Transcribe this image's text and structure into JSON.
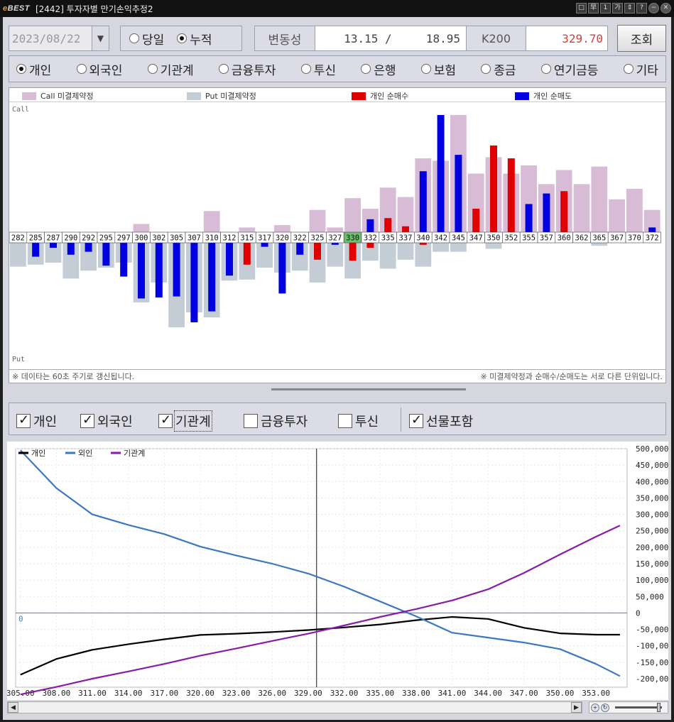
{
  "window": {
    "logo": "BEST",
    "title": "[2442] 투자자별 만기손익추정2",
    "controls": [
      "□",
      "早",
      "1",
      "가",
      "⇕",
      "?",
      "−",
      "✕"
    ]
  },
  "top": {
    "date": "2023/08/22",
    "mode_options": [
      {
        "label": "당일",
        "selected": false
      },
      {
        "label": "누적",
        "selected": true
      }
    ],
    "vol_label": "변동성",
    "vol_value": "13.15 /     18.95",
    "k200_label": "K200",
    "k200_value": "329.70",
    "query_button": "조회"
  },
  "investors": [
    {
      "label": "개인",
      "selected": true
    },
    {
      "label": "외국인",
      "selected": false
    },
    {
      "label": "기관계",
      "selected": false
    },
    {
      "label": "금융투자",
      "selected": false
    },
    {
      "label": "투신",
      "selected": false
    },
    {
      "label": "은행",
      "selected": false
    },
    {
      "label": "보험",
      "selected": false
    },
    {
      "label": "종금",
      "selected": false
    },
    {
      "label": "연기금등",
      "selected": false
    },
    {
      "label": "기타",
      "selected": false
    }
  ],
  "bar_panel": {
    "legend": [
      {
        "label": "Call 미결제약정",
        "color": "#d8bcd6"
      },
      {
        "label": "Put 미결제약정",
        "color": "#c4ccd6"
      },
      {
        "label": "개인 순매수",
        "color": "#e00000"
      },
      {
        "label": "개인 순매도",
        "color": "#0000e0"
      }
    ],
    "call_label": "Call",
    "put_label": "Put",
    "note_left": "※ 데이타는 60초 주기로 갱신됩니다.",
    "note_right": "※ 미결제약정과 순매수/순매도는 서로 다른 단위입니다.",
    "highlight_strike": "330"
  },
  "checks": {
    "items": [
      {
        "label": "개인",
        "checked": true
      },
      {
        "label": "외국인",
        "checked": true
      },
      {
        "label": "기관계",
        "checked": true
      },
      {
        "label": "금융투자",
        "checked": false
      },
      {
        "label": "투신",
        "checked": false
      }
    ],
    "futures": {
      "label": "선물포함",
      "checked": true
    }
  },
  "line_legend": [
    {
      "label": "개인",
      "color": "#000000"
    },
    {
      "label": "외인",
      "color": "#3a78c0"
    },
    {
      "label": "기관계",
      "color": "#8a1aa8"
    }
  ],
  "chart_data": [
    {
      "type": "bar",
      "categories": [
        "282",
        "285",
        "287",
        "290",
        "292",
        "295",
        "297",
        "300",
        "302",
        "305",
        "307",
        "310",
        "312",
        "315",
        "317",
        "320",
        "322",
        "325",
        "327",
        "330",
        "332",
        "335",
        "337",
        "340",
        "342",
        "345",
        "347",
        "350",
        "352",
        "355",
        "357",
        "360",
        "362",
        "365",
        "367",
        "370",
        "372"
      ],
      "series": [
        {
          "name": "Call 미결제약정",
          "values": [
            0,
            0,
            0,
            0,
            0,
            0,
            0,
            7,
            0,
            0,
            0,
            18,
            0,
            4,
            0,
            6,
            0,
            19,
            4,
            29,
            20,
            38,
            30,
            63,
            61,
            100,
            50,
            64,
            50,
            57,
            41,
            53,
            41,
            56,
            28,
            37,
            19
          ]
        },
        {
          "name": "개인 순매수",
          "values": [
            0,
            0,
            0,
            0,
            0,
            0,
            0,
            0,
            0,
            0,
            0,
            0,
            0,
            -22,
            0,
            0,
            0,
            -17,
            0,
            -18,
            -5,
            12,
            5,
            -2,
            0,
            0,
            20,
            74,
            63,
            0,
            0,
            35,
            0,
            0,
            0,
            0,
            0
          ]
        },
        {
          "name": "개인 순매도",
          "values": [
            0,
            -14,
            -5,
            -12,
            -9,
            -23,
            -34,
            -56,
            -55,
            -54,
            -80,
            -69,
            -33,
            0,
            -4,
            -51,
            -12,
            0,
            -2,
            0,
            11,
            0,
            0,
            52,
            100,
            66,
            0,
            0,
            0,
            24,
            33,
            0,
            0,
            0,
            0,
            0,
            4
          ]
        },
        {
          "name": "Put 미결제약정",
          "values": [
            -24,
            -22,
            -20,
            -36,
            -28,
            -25,
            -20,
            -60,
            -40,
            -85,
            -70,
            -75,
            -38,
            -37,
            -25,
            -30,
            -28,
            -40,
            -24,
            -36,
            -18,
            -26,
            -17,
            -24,
            -9,
            -9,
            0,
            -6,
            0,
            0,
            0,
            0,
            0,
            -3,
            0,
            0,
            0
          ]
        }
      ],
      "legend_position": "top",
      "units": "relative"
    },
    {
      "type": "line",
      "x": [
        305,
        308,
        311,
        314,
        317,
        320,
        323,
        326,
        329,
        332,
        335,
        338,
        341,
        344,
        347,
        350,
        353,
        355
      ],
      "xticks": [
        "305.00",
        "308.00",
        "311.00",
        "314.00",
        "317.00",
        "320.00",
        "323.00",
        "326.00",
        "329.00",
        "332.00",
        "335.00",
        "338.00",
        "341.00",
        "344.00",
        "347.00",
        "350.00",
        "353.00"
      ],
      "yticks": [
        "500,000",
        "450,000",
        "400,000",
        "350,000",
        "300,000",
        "250,000",
        "200,000",
        "150,000",
        "100,000",
        "50,000",
        "0",
        "-50,000",
        "-100,000",
        "-150,000",
        "-200,000"
      ],
      "ylim": [
        -200000,
        500000
      ],
      "series": [
        {
          "name": "개인",
          "values": [
            -188000,
            -140000,
            -112000,
            -95000,
            -80000,
            -67000,
            -63000,
            -58000,
            -52000,
            -44000,
            -35000,
            -22000,
            -12000,
            -18000,
            -45000,
            -62000,
            -66000,
            -66000
          ]
        },
        {
          "name": "외인",
          "values": [
            495000,
            380000,
            300000,
            268000,
            240000,
            202000,
            175000,
            150000,
            120000,
            80000,
            35000,
            -10000,
            -60000,
            -75000,
            -90000,
            -110000,
            -155000,
            -192000
          ]
        },
        {
          "name": "기관계",
          "values": [
            -248000,
            -225000,
            -200000,
            -178000,
            -155000,
            -130000,
            -108000,
            -85000,
            -63000,
            -38000,
            -12000,
            12000,
            38000,
            72000,
            122000,
            178000,
            232000,
            266000
          ]
        }
      ],
      "zero_label": "0",
      "vertical_marker_x": 329.7,
      "legend_position": "top-left"
    }
  ]
}
